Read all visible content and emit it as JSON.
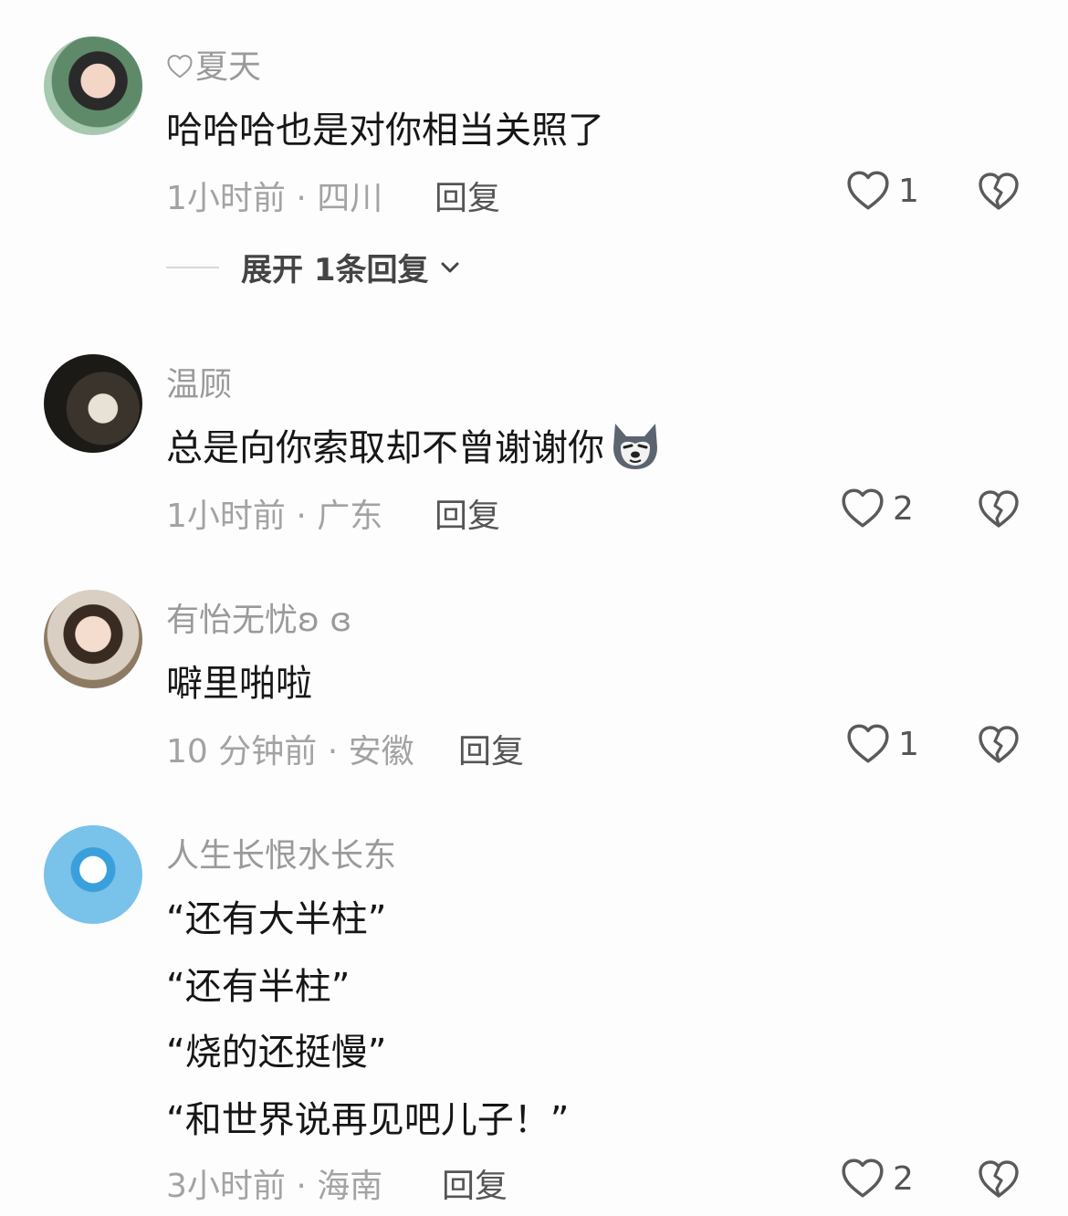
{
  "comments": [
    {
      "username": "夏天",
      "text_lines": [
        "哈哈哈也是对你相当关照了"
      ],
      "meta": "1小时前 · 四川",
      "reply_label": "回复",
      "likes": "1",
      "expand_label": "展开 1条回复"
    },
    {
      "username": "温顾",
      "text_lines": [
        "总是向你索取却不曾谢谢你"
      ],
      "meta": "1小时前 · 广东",
      "reply_label": "回复",
      "likes": "2"
    },
    {
      "username": "有怡无忧ʚ ɞ",
      "text_lines": [
        "噼里啪啦"
      ],
      "meta": "10 分钟前 · 安徽",
      "reply_label": "回复",
      "likes": "1"
    },
    {
      "username": "人生长恨水长东",
      "text_lines": [
        "“还有大半柱”",
        "“还有半柱”",
        "“烧的还挺慢”",
        "“和世界说再见吧儿子！”"
      ],
      "meta": "3小时前 · 海南",
      "reply_label": "回复",
      "likes": "2"
    }
  ],
  "icons": {
    "like": "heart-outline-icon",
    "dislike": "broken-heart-icon",
    "expand": "chevron-down-icon",
    "emoji": "husky-dog-emoji"
  },
  "colors": {
    "background": "#fdfdfd",
    "text": "#161616",
    "secondary": "#a3a3a3",
    "icon": "#555555"
  }
}
